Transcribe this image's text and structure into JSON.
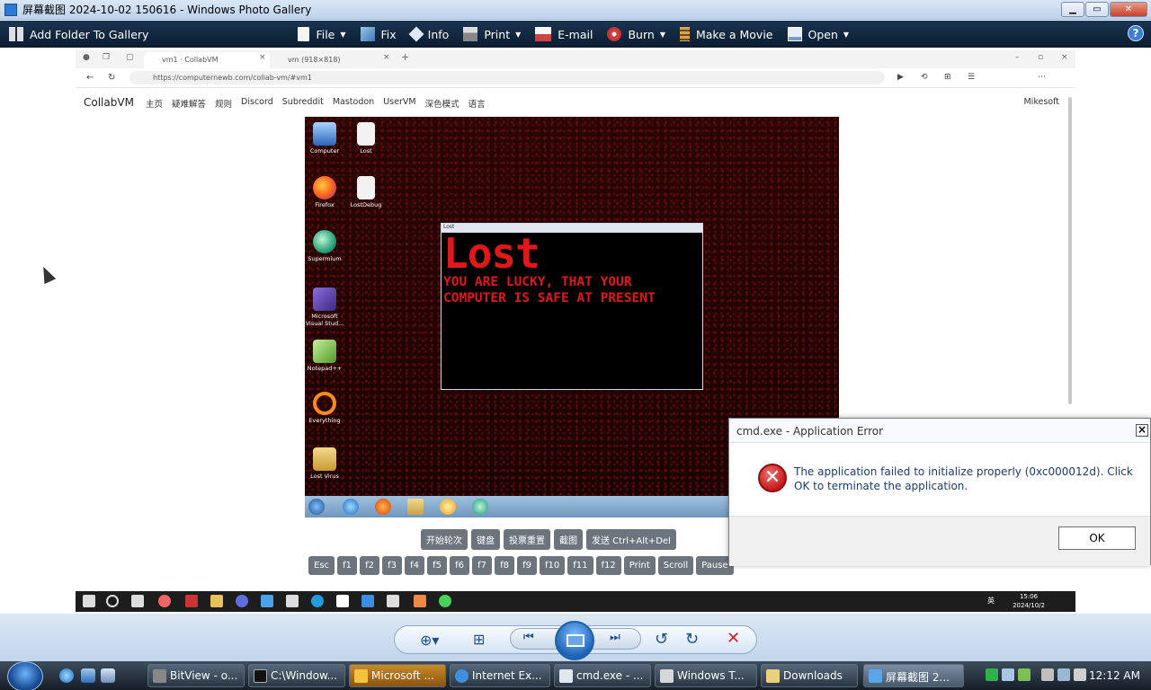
{
  "window": {
    "title": "屏幕截图 2024-10-02 150616 - Windows Photo Gallery",
    "buttons": {
      "minimize": "▁",
      "maximize": "▭",
      "close": "✕"
    }
  },
  "toolbar": {
    "add_folder": "Add Folder To Gallery",
    "file": "File",
    "fix": "Fix",
    "info": "Info",
    "print": "Print",
    "email": "E-mail",
    "burn": "Burn",
    "make_movie": "Make a Movie",
    "open": "Open",
    "help": "?"
  },
  "browser": {
    "tab1": "vm1 · CollabVM",
    "tab2": "vm (918×818)",
    "url": "https://computernewb.com/collab-vm/#vm1"
  },
  "site": {
    "brand": "CollabVM",
    "menu": [
      "主页",
      "疑难解答",
      "规则",
      "Discord",
      "Subreddit",
      "Mastodon",
      "UserVM",
      "深色模式",
      "语言"
    ],
    "user": "Mikesoft"
  },
  "vm_desktop": {
    "icons": [
      "Computer",
      "Lost",
      "Firefox",
      "LostDebug",
      "Supermium",
      "Microsoft Visual Stud...",
      "Notepad++",
      "Everything",
      "Lost Virus"
    ],
    "lost_window": {
      "caption": "Lost",
      "heading": "Lost",
      "line1": "YOU ARE LUCKY, THAT YOUR",
      "line2": "COMPUTER IS SAFE AT PRESENT"
    }
  },
  "vm_controls": {
    "buttons": [
      "开始轮次",
      "键盘",
      "投票重置",
      "截图",
      "发送 Ctrl+Alt+Del"
    ],
    "keys": [
      "Esc",
      "f1",
      "f2",
      "f3",
      "f4",
      "f5",
      "f6",
      "f7",
      "f8",
      "f9",
      "f10",
      "f11",
      "f12",
      "Print",
      "Scroll",
      "Pause"
    ]
  },
  "host_taskbar": {
    "time": "15:06",
    "date": "2024/10/2",
    "ime": "英"
  },
  "dialog": {
    "title": "cmd.exe - Application Error",
    "message": "The application failed to initialize properly (0xc000012d). Click OK to terminate the application.",
    "ok": "OK"
  },
  "taskbar": {
    "items": [
      "BitView - o...",
      "C:\\Window...",
      "Microsoft ...",
      "Internet Ex...",
      "cmd.exe - ...",
      "Windows T...",
      "Downloads",
      "屏幕截图 2..."
    ],
    "clock": "12:12 AM"
  },
  "colors": {
    "toolbar_bg": "#0a1c30",
    "lost_red": "#e0181a",
    "error_red": "#c41a1a"
  }
}
